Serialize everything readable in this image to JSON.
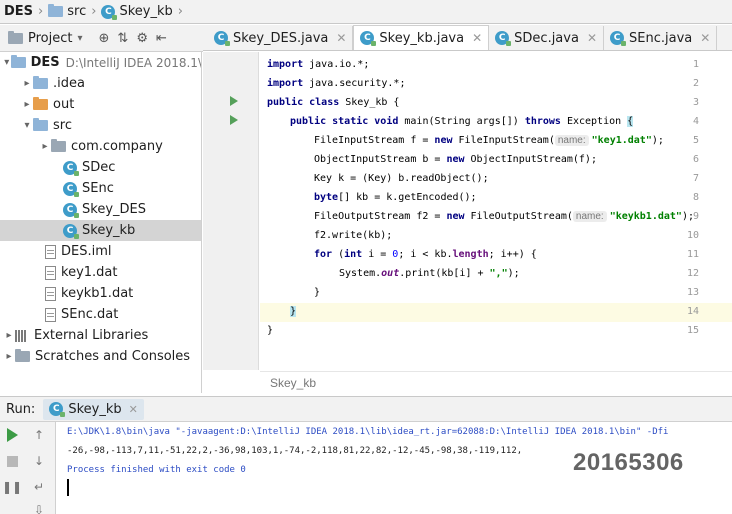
{
  "breadcrumb": [
    "DES",
    "src",
    "Skey_kb"
  ],
  "project_panel": {
    "title": "Project"
  },
  "tree": [
    {
      "label": "DES",
      "path": "D:\\IntelliJ IDEA 2018.1\\",
      "arrow": "▾",
      "icon": "folder",
      "bold": true
    },
    {
      "label": ".idea",
      "arrow": "▸",
      "icon": "folder"
    },
    {
      "label": "out",
      "arrow": "▸",
      "icon": "folder-orange"
    },
    {
      "label": "src",
      "arrow": "▾",
      "icon": "folder"
    },
    {
      "label": "com.company",
      "arrow": "▸",
      "icon": "folder-grey"
    },
    {
      "label": "SDec",
      "arrow": "",
      "icon": "class"
    },
    {
      "label": "SEnc",
      "arrow": "",
      "icon": "class"
    },
    {
      "label": "Skey_DES",
      "arrow": "",
      "icon": "class"
    },
    {
      "label": "Skey_kb",
      "arrow": "",
      "icon": "class",
      "selected": true
    },
    {
      "label": "DES.iml",
      "arrow": "",
      "icon": "file"
    },
    {
      "label": "key1.dat",
      "arrow": "",
      "icon": "file"
    },
    {
      "label": "keykb1.dat",
      "arrow": "",
      "icon": "file"
    },
    {
      "label": "SEnc.dat",
      "arrow": "",
      "icon": "file"
    },
    {
      "label": "External Libraries",
      "arrow": "▸",
      "icon": "library"
    },
    {
      "label": "Scratches and Consoles",
      "arrow": "▸",
      "icon": "scratch"
    }
  ],
  "tabs": [
    {
      "label": "Skey_DES.java",
      "active": false
    },
    {
      "label": "Skey_kb.java",
      "active": true
    },
    {
      "label": "SDec.java",
      "active": false
    },
    {
      "label": "SEnc.java",
      "active": false
    }
  ],
  "code": {
    "line_numbers": [
      "1",
      "2",
      "3",
      "4",
      "5",
      "6",
      "7",
      "8",
      "9",
      "10",
      "11",
      "12",
      "13",
      "14",
      "15"
    ],
    "l1_kw": "import",
    "l1_rest": " java.io.*;",
    "l2_kw": "import",
    "l2_rest": " java.security.*;",
    "l3_kw": "public class",
    "l3_rest": " Skey_kb {",
    "l4_kw": "public static void",
    "l4_mid": " main(String args[]) ",
    "l4_kw2": "throws",
    "l4_rest": " Exception ",
    "l4_brace": "{",
    "l5_a": "FileInputStream f = ",
    "l5_kw": "new",
    "l5_b": " FileInputStream(",
    "l5_hint": "name:",
    "l5_str": "\"key1.dat\"",
    "l5_end": ");",
    "l6_a": "ObjectInputStream b = ",
    "l6_kw": "new",
    "l6_b": " ObjectInputStream(f);",
    "l7": "Key k = (Key) b.readObject();",
    "l8_kw": "byte",
    "l8_rest": "[] kb = k.getEncoded();",
    "l9_a": "FileOutputStream f2 = ",
    "l9_kw": "new",
    "l9_b": " FileOutputStream(",
    "l9_hint": "name:",
    "l9_str": "\"keykb1.dat\"",
    "l9_end": ");",
    "l10": "f2.write(kb);",
    "l11_kw": "for",
    "l11_a": " (",
    "l11_kw2": "int",
    "l11_b": " i = ",
    "l11_num": "0",
    "l11_c": "; i < kb.",
    "l11_fd": "length",
    "l11_d": "; i++) {",
    "l12_a": "System.",
    "l12_fd": "out",
    "l12_b": ".print(kb[i] + ",
    "l12_str": "\",\"",
    "l12_end": ");",
    "l13": "}",
    "l14": "}",
    "l15": "}"
  },
  "editor_breadcrumb": "Skey_kb",
  "run_panel": {
    "label": "Run:",
    "tab": "Skey_kb",
    "lines": [
      "E:\\JDK\\1.8\\bin\\java \"-javaagent:D:\\IntelliJ IDEA 2018.1\\lib\\idea_rt.jar=62088:D:\\IntelliJ IDEA 2018.1\\bin\" -Dfi",
      "-26,-98,-113,7,11,-51,22,2,-36,98,103,1,-74,-2,118,81,22,82,-12,-45,-98,38,-119,112,",
      "Process finished with exit code 0"
    ]
  },
  "watermark": "20165306",
  "colors": {
    "keyword": "#000080",
    "string": "#008000",
    "field": "#660e7a",
    "run_green": "#3c9b45"
  }
}
